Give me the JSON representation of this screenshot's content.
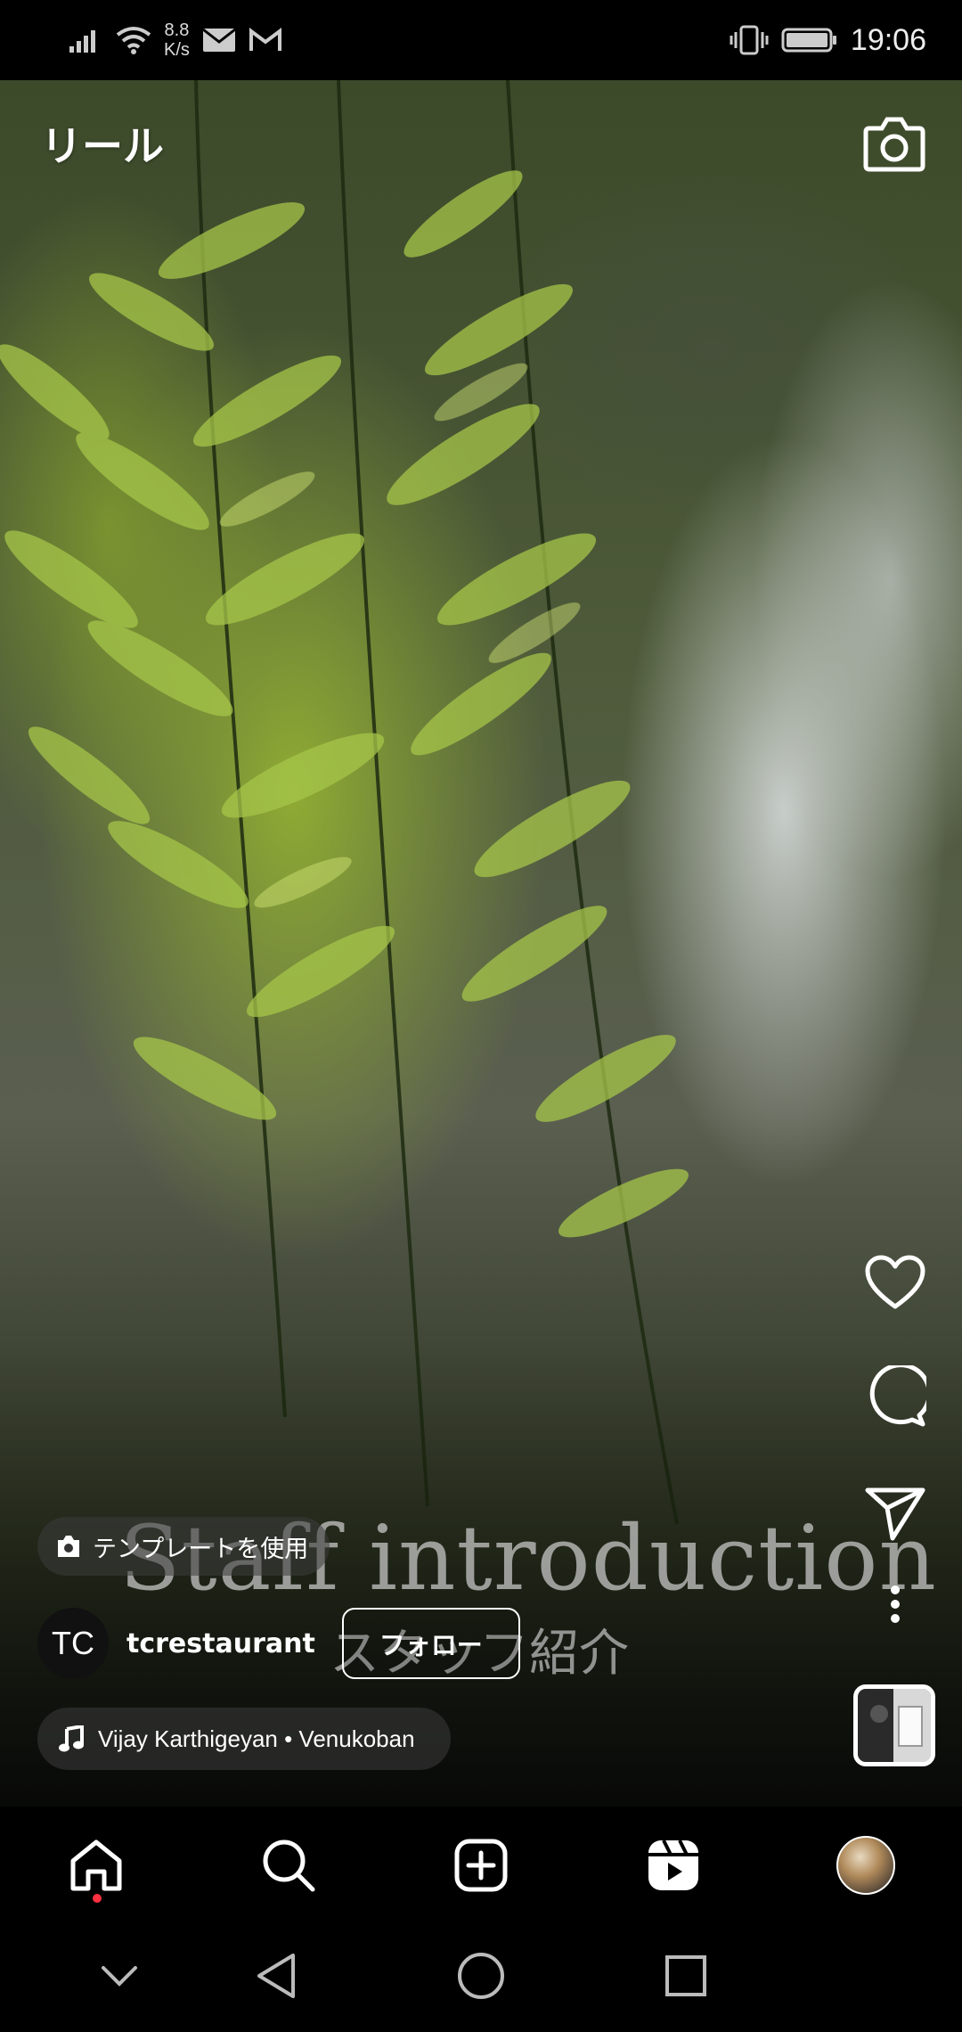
{
  "status_bar": {
    "speed_value": "8.8",
    "speed_unit": "K/s",
    "time": "19:06",
    "icons": [
      "signal-icon",
      "wifi-icon",
      "mail-icon",
      "gmail-icon",
      "vibrate-icon",
      "battery-icon"
    ]
  },
  "header": {
    "title": "リール",
    "camera_icon": "camera-icon"
  },
  "video": {
    "caption_en": "Staff introduction",
    "caption_jp": "スタッフ紹介"
  },
  "template": {
    "label": "テンプレートを使用",
    "icon": "camera-icon"
  },
  "account": {
    "avatar_initials": "TC",
    "username": "tcrestaurant",
    "follow_label": "フォロー"
  },
  "music": {
    "icon": "music-note-icon",
    "text": "Vijay Karthigeyan • Venukoban"
  },
  "actions": [
    "heart-icon",
    "comment-icon",
    "send-icon",
    "more-icon"
  ],
  "bottom_nav": [
    "home-icon",
    "search-icon",
    "create-icon",
    "reels-icon",
    "profile-avatar"
  ],
  "system_nav": [
    "chevron-down-icon",
    "back-icon",
    "home-circle-icon",
    "recents-icon"
  ],
  "colors": {
    "background": "#000000",
    "notification_dot": "#ff3040",
    "text": "#ffffff"
  }
}
